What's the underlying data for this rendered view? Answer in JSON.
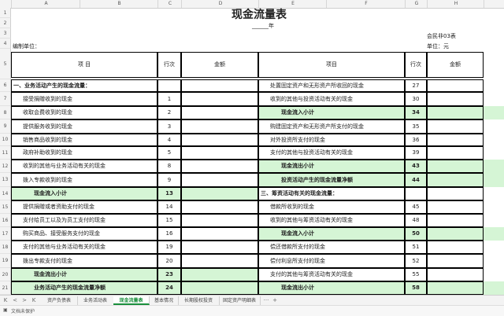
{
  "columns": [
    "A",
    "B",
    "C",
    "D",
    "E",
    "F",
    "G",
    "H"
  ],
  "row_numbers": [
    "1",
    "2",
    "3",
    "4",
    "5",
    "6",
    "7",
    "8",
    "9",
    "10",
    "11",
    "12",
    "13",
    "14",
    "15",
    "16",
    "17",
    "18",
    "19",
    "20",
    "21"
  ],
  "header": {
    "title": "现金流量表",
    "year_suffix": "______年",
    "form_code": "会民非03表",
    "unit_label": "编制单位：",
    "unit_currency": "单位：元"
  },
  "table_header": {
    "item": "项          目",
    "row_no": "行次",
    "amount": "金额",
    "item_right": "项目",
    "row_no_right": "行次"
  },
  "left_rows": [
    {
      "label": "一、业务活动产生的现金流量：",
      "no": ""
    },
    {
      "label": "接受捐赠收到的现金",
      "no": "1"
    },
    {
      "label": "收取会费收到的现金",
      "no": "2"
    },
    {
      "label": "提供服务收到的现金",
      "no": "3"
    },
    {
      "label": "销售商品收到的现金",
      "no": "4"
    },
    {
      "label": "政府补助收到的现金",
      "no": "5"
    },
    {
      "label": "收到的其他与业务活动有关的现金",
      "no": "8"
    },
    {
      "label": "拨入专款收到的现金",
      "no": "9"
    },
    {
      "label": "现金流入小计",
      "no": "13"
    },
    {
      "label": "提供捐赠或者资助支付的现金",
      "no": "14"
    },
    {
      "label": "支付给员工以及为员工支付的现金",
      "no": "15"
    },
    {
      "label": "购买商品、接受服务支付的现金",
      "no": "16"
    },
    {
      "label": "支付的其他与业务活动有关的现金",
      "no": "19"
    },
    {
      "label": "拨出专款支付的现金",
      "no": "20"
    },
    {
      "label": "现金流出小计",
      "no": "23"
    },
    {
      "label": "业务活动产生的现金流量净额",
      "no": "24"
    }
  ],
  "right_rows": [
    {
      "label": "处置固定资产和无形资产所收回的现金",
      "no": "27"
    },
    {
      "label": "收到的其他与投资活动有关的现金",
      "no": "30"
    },
    {
      "label": "现金流入小计",
      "no": "34"
    },
    {
      "label": "购建固定资产和无形资产所支付的现金",
      "no": "35"
    },
    {
      "label": "对外投资所支付的现金",
      "no": "36"
    },
    {
      "label": "支付的其他与投资活动有关的现金",
      "no": "39"
    },
    {
      "label": "现金流出小计",
      "no": "43"
    },
    {
      "label": "投资活动产生的现金流量净额",
      "no": "44"
    },
    {
      "label": "三、筹资活动有关的现金流量：",
      "no": ""
    },
    {
      "label": "借款所收到的现金",
      "no": "45"
    },
    {
      "label": "收到的其他与筹资活动有关的现金",
      "no": "48"
    },
    {
      "label": "现金流入小计",
      "no": "50"
    },
    {
      "label": "偿还借款所支付的现金",
      "no": "51"
    },
    {
      "label": "偿付利息所支付的现金",
      "no": "52"
    },
    {
      "label": "支付的其他与筹资活动有关的现金",
      "no": "55"
    },
    {
      "label": "现金流出小计",
      "no": "58"
    }
  ],
  "sheet_tabs": [
    "资产负债表",
    "业务活动表",
    "现金流量表",
    "基本情况",
    "长期股权投资",
    "固定资产明细表"
  ],
  "active_tab": "现金流量表",
  "nav": {
    "first": "K",
    "prev": "<",
    "next": ">",
    "last": "K",
    "more": "···",
    "add": "+"
  },
  "status_text": "文档未保护",
  "colors": {
    "green": "#d5f5d5",
    "active_tab": "#1a8f3c"
  }
}
